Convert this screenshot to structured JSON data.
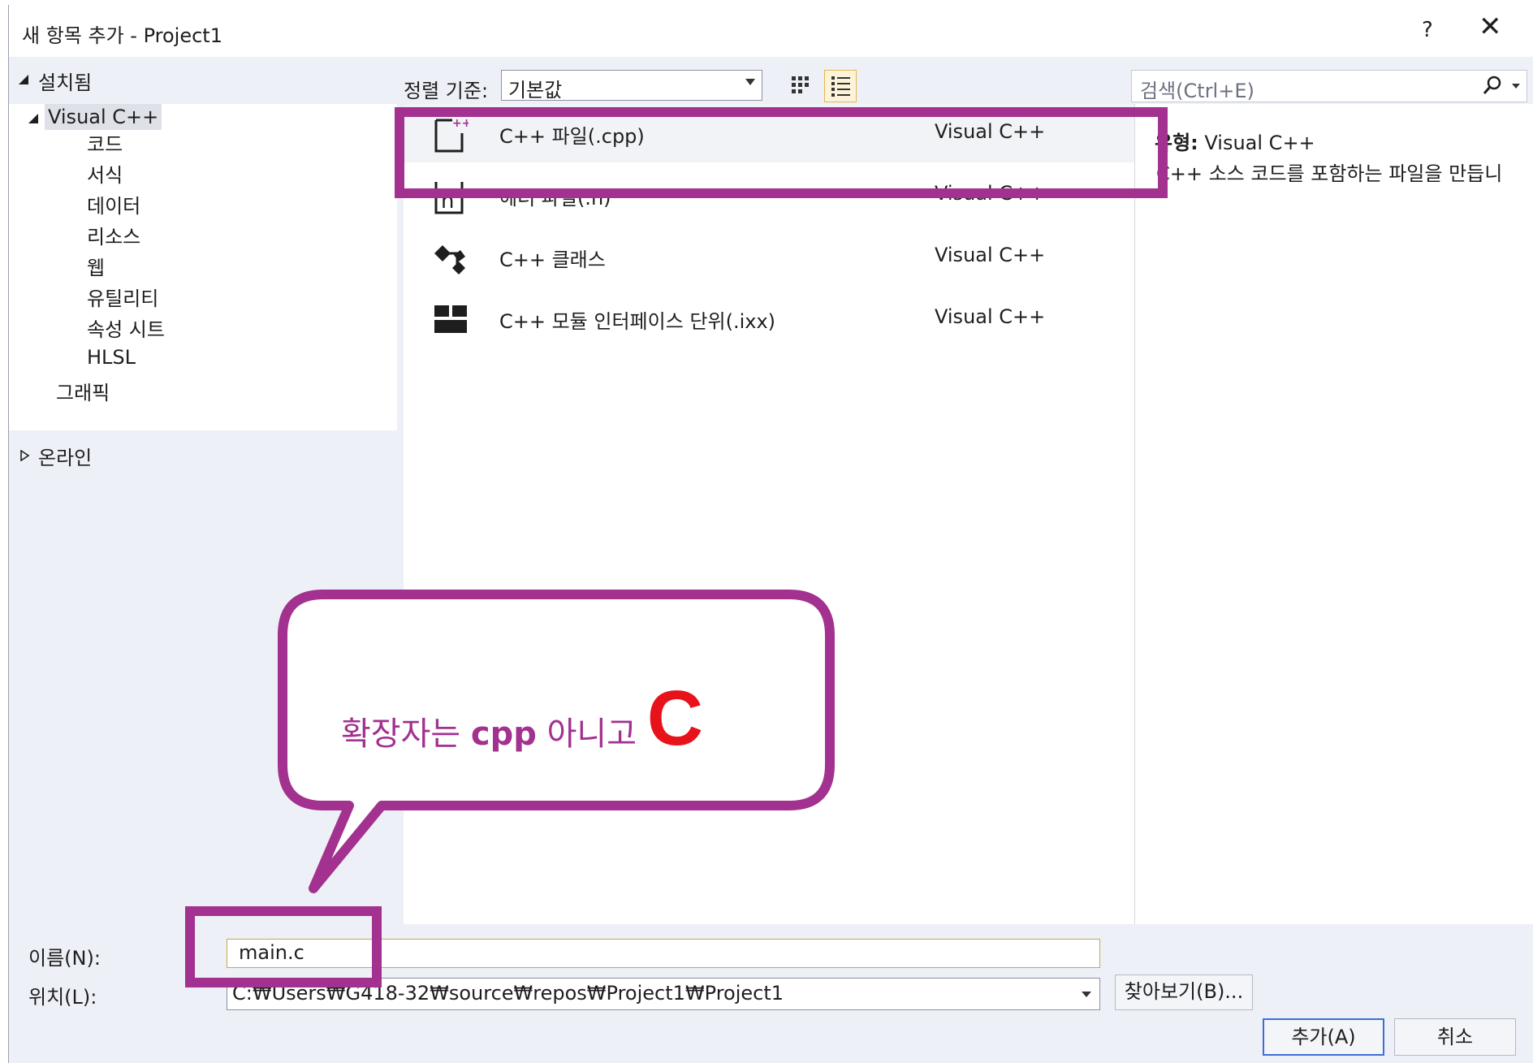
{
  "window": {
    "title": "새 항목 추가 - Project1",
    "help_label": "?",
    "close_label": "✕"
  },
  "left_panel": {
    "installed_label": "설치됨",
    "tree": {
      "visual_cpp": "Visual C++",
      "children": [
        "코드",
        "서식",
        "데이터",
        "리소스",
        "웹",
        "유틸리티",
        "속성 시트",
        "HLSL"
      ],
      "graphics": "그래픽"
    },
    "online_label": "온라인"
  },
  "toolbar": {
    "sort_label": "정렬 기준:",
    "sort_value": "기본값",
    "search_placeholder": "검색(Ctrl+E)"
  },
  "templates": [
    {
      "name": "C++ 파일(.cpp)",
      "language": "Visual C++",
      "icon": "cpp-file-icon"
    },
    {
      "name": "헤더 파일(.h)",
      "language": "Visual C++",
      "icon": "header-file-icon"
    },
    {
      "name": "C++ 클래스",
      "language": "Visual C++",
      "icon": "class-icon"
    },
    {
      "name": "C++ 모듈 인터페이스 단위(.ixx)",
      "language": "Visual C++",
      "icon": "module-icon"
    }
  ],
  "details": {
    "type_label": "유형:",
    "type_value": "Visual C++",
    "description": "C++ 소스 코드를 포함하는 파일을 만듭니"
  },
  "form": {
    "name_label": "이름(N):",
    "name_value": "main.c",
    "location_label": "위치(L):",
    "location_value": "C:₩Users₩G418-32₩source₩repos₩Project1₩Project1",
    "browse_label": "찾아보기(B)...",
    "add_label": "추가(A)",
    "cancel_label": "취소"
  },
  "annotation": {
    "prefix": "확장자는",
    "cpp": "cpp",
    "middle": "아니고",
    "c": "C"
  },
  "colors": {
    "annotation_purple": "#a2318f",
    "annotation_red": "#e8121a",
    "selection_bg": "#f2f3f6"
  }
}
